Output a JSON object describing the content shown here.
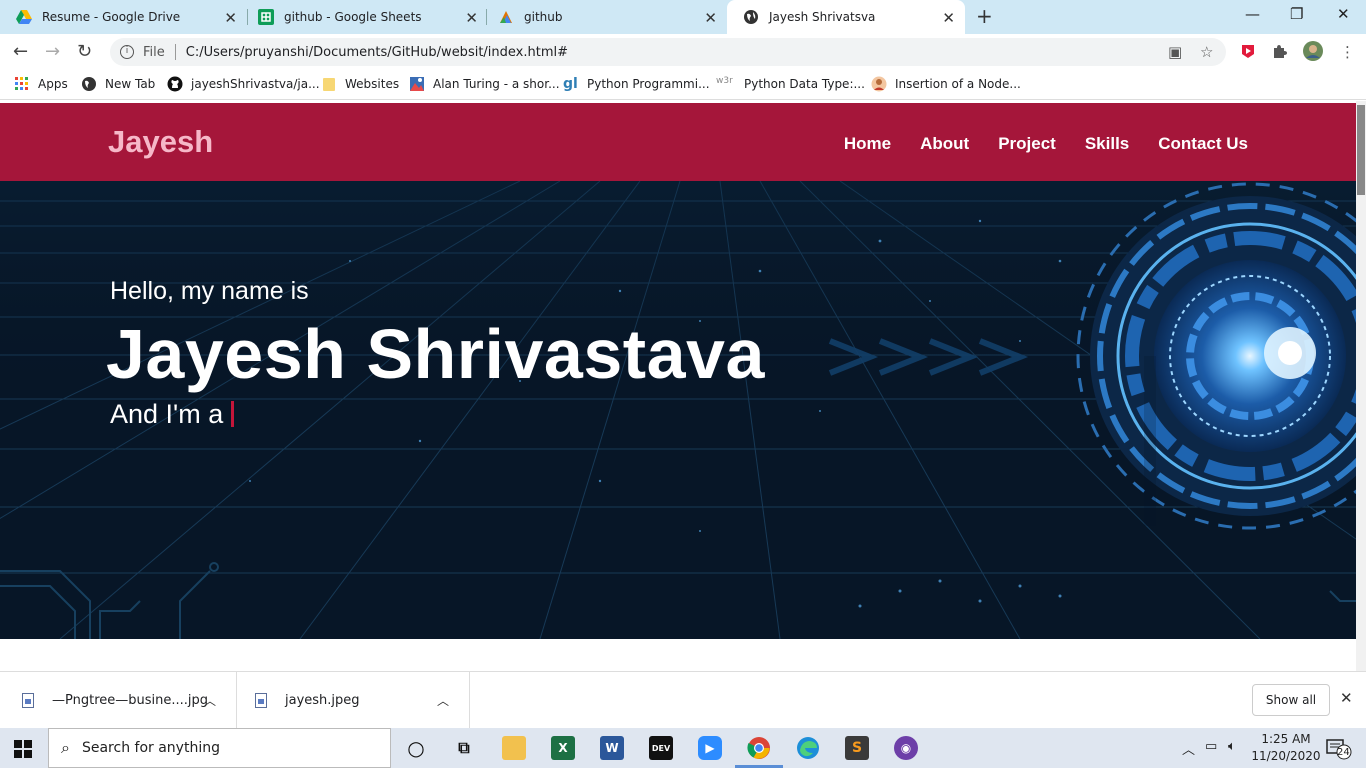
{
  "browser": {
    "tabs": [
      {
        "title": "Resume - Google Drive",
        "icon": "google-drive-icon"
      },
      {
        "title": "github - Google Sheets",
        "icon": "google-sheets-icon"
      },
      {
        "title": "github",
        "icon": "github-pages-icon"
      },
      {
        "title": "Jayesh Shrivatsva",
        "icon": "globe-icon",
        "active": true
      }
    ],
    "address": {
      "scheme_label": "File",
      "url": "C:/Users/pruyanshi/Documents/GitHub/websit/index.html#"
    },
    "bookmarks": [
      {
        "label": "Apps",
        "icon": "apps-grid-icon"
      },
      {
        "label": "New Tab",
        "icon": "globe-icon"
      },
      {
        "label": "jayeshShrivastva/ja...",
        "icon": "github-icon"
      },
      {
        "label": "Websites",
        "icon": "folder-icon"
      },
      {
        "label": "Alan Turing - a shor...",
        "icon": "image-icon"
      },
      {
        "label": "Python Programmi...",
        "icon": "gl-icon"
      },
      {
        "label": "Python Data Type:...",
        "icon": "w3r-icon"
      },
      {
        "label": "Insertion of a Node...",
        "icon": "avatar-icon"
      }
    ],
    "bookmark_w3r_text": "w3r"
  },
  "site": {
    "logo": "Jayesh",
    "nav": [
      "Home",
      "About",
      "Project",
      "Skills",
      "Contact Us"
    ],
    "hero": {
      "greeting": "Hello, my name is",
      "name": "Jayesh Shrivastava",
      "typed_prefix": "And I'm a"
    },
    "colors": {
      "navbar": "#a5163a",
      "logo": "#f6b8c8",
      "hero_bg": "#071627",
      "cursor": "#c4163a"
    }
  },
  "downloads": {
    "items": [
      {
        "name": "—Pngtree—busine....jpg"
      },
      {
        "name": "jayesh.jpeg"
      }
    ],
    "show_all": "Show all"
  },
  "taskbar": {
    "search_placeholder": "Search for anything",
    "dev_label": "DEV",
    "time": "1:25 AM",
    "date": "11/20/2020",
    "notification_count": "24"
  }
}
